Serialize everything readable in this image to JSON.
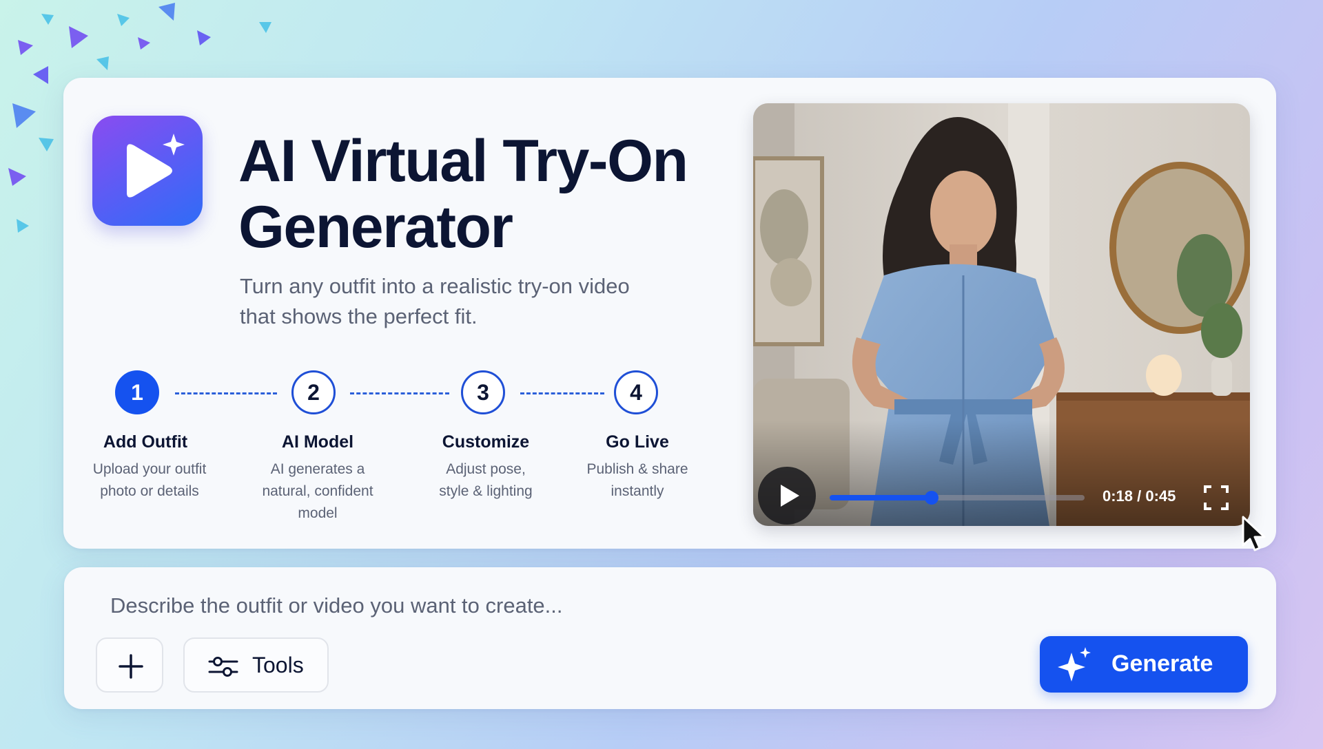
{
  "hero": {
    "title_line1": "AI Virtual Try-On",
    "title_line2": "Generator",
    "subtitle_line1": "Turn any outfit into a realistic try-on video",
    "subtitle_line2": "that shows the perfect fit."
  },
  "steps": [
    {
      "number": "1",
      "title": "Add Outfit",
      "desc_lines": [
        "Upload your outfit",
        "photo or details"
      ],
      "active": true
    },
    {
      "number": "2",
      "title": "AI Model",
      "desc_lines": [
        "AI generates a",
        "natural, confident",
        "model"
      ],
      "active": false
    },
    {
      "number": "3",
      "title": "Customize",
      "desc_lines": [
        "Adjust pose,",
        "style & lighting"
      ],
      "active": false
    },
    {
      "number": "4",
      "title": "Go Live",
      "desc_lines": [
        "Publish & share",
        "instantly"
      ],
      "active": false
    }
  ],
  "video": {
    "current_time": "0:18",
    "duration": "0:45",
    "time_display": "0:18 / 0:45",
    "progress_fraction": 0.4
  },
  "prompt": {
    "placeholder": "Describe the outfit or video you want to create..."
  },
  "toolbar": {
    "add_icon": "plus-icon",
    "tools_label": "Tools",
    "tools_icon": "sliders-icon",
    "generate_label": "Generate",
    "generate_icon": "sparkle-icon"
  },
  "colors": {
    "accent": "#1552ef",
    "title": "#0c1533",
    "muted": "#5b6275"
  }
}
